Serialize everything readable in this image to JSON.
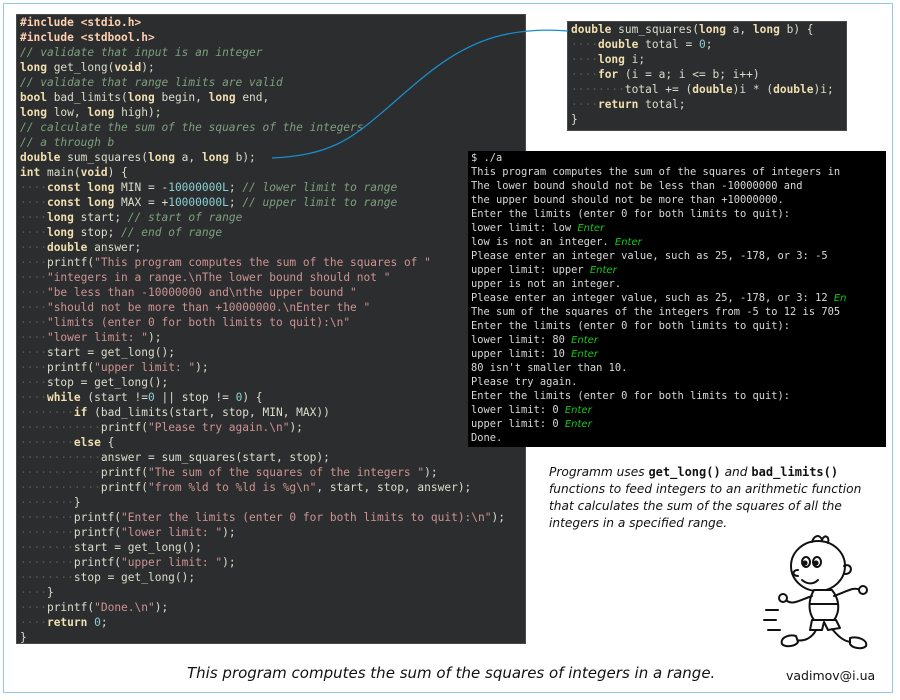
{
  "main_code": [
    [
      [
        "#include <stdio.h>",
        "pp"
      ]
    ],
    [
      [
        "#include <stdbool.h>",
        "pp"
      ]
    ],
    [
      [
        "// validate that input is an integer",
        "cm"
      ]
    ],
    [
      [
        "long",
        "kw"
      ],
      [
        " get_long(",
        ""
      ],
      [
        "void",
        "kw"
      ],
      [
        ");",
        ""
      ]
    ],
    [
      [
        "// validate that range limits are valid",
        "cm"
      ]
    ],
    [
      [
        "bool",
        "kw"
      ],
      [
        " bad_limits(",
        ""
      ],
      [
        "long",
        "kw"
      ],
      [
        " begin, ",
        ""
      ],
      [
        "long",
        "kw"
      ],
      [
        " end,",
        ""
      ]
    ],
    [
      [
        "long",
        "kw"
      ],
      [
        " low, ",
        ""
      ],
      [
        "long",
        "kw"
      ],
      [
        " high);",
        ""
      ]
    ],
    [
      [
        "// calculate the sum of the squares of the integers",
        "cm"
      ]
    ],
    [
      [
        "// a through b",
        "cm"
      ]
    ],
    [
      [
        "double",
        "kw"
      ],
      [
        " sum_squares(",
        ""
      ],
      [
        "long",
        "kw"
      ],
      [
        " a, ",
        ""
      ],
      [
        "long",
        "kw"
      ],
      [
        " b);",
        ""
      ]
    ],
    [
      [
        "int",
        "kw"
      ],
      [
        " main(",
        ""
      ],
      [
        "void",
        "kw"
      ],
      [
        ") {",
        ""
      ]
    ],
    [
      [
        "····",
        "ws"
      ],
      [
        "const long",
        "kw"
      ],
      [
        " MIN = -",
        ""
      ],
      [
        "10000000L",
        "nm"
      ],
      [
        "; ",
        ""
      ],
      [
        "// lower limit to range",
        "cm"
      ]
    ],
    [
      [
        "····",
        "ws"
      ],
      [
        "const long",
        "kw"
      ],
      [
        " MAX = +",
        ""
      ],
      [
        "10000000L",
        "nm"
      ],
      [
        "; ",
        ""
      ],
      [
        "// upper limit to range",
        "cm"
      ]
    ],
    [
      [
        "····",
        "ws"
      ],
      [
        "long",
        "kw"
      ],
      [
        " start; ",
        ""
      ],
      [
        "// start of range",
        "cm"
      ]
    ],
    [
      [
        "····",
        "ws"
      ],
      [
        "long",
        "kw"
      ],
      [
        " stop; ",
        ""
      ],
      [
        "// end of range",
        "cm"
      ]
    ],
    [
      [
        "····",
        "ws"
      ],
      [
        "double",
        "kw"
      ],
      [
        " answer;",
        ""
      ]
    ],
    [
      [
        "····",
        "ws"
      ],
      [
        "printf(",
        ""
      ],
      [
        "\"This program computes the sum of the squares of \"",
        "st"
      ]
    ],
    [
      [
        "····",
        "ws"
      ],
      [
        "\"integers in a range.\\nThe lower bound should not \"",
        "st"
      ]
    ],
    [
      [
        "····",
        "ws"
      ],
      [
        "\"be less than -10000000 and\\nthe upper bound \"",
        "st"
      ]
    ],
    [
      [
        "····",
        "ws"
      ],
      [
        "\"should not be more than +10000000.\\nEnter the \"",
        "st"
      ]
    ],
    [
      [
        "····",
        "ws"
      ],
      [
        "\"limits (enter 0 for both limits to quit):\\n\"",
        "st"
      ]
    ],
    [
      [
        "····",
        "ws"
      ],
      [
        "\"lower limit: \"",
        "st"
      ],
      [
        ");",
        ""
      ]
    ],
    [
      [
        "····",
        "ws"
      ],
      [
        "start = get_long();",
        ""
      ]
    ],
    [
      [
        "····",
        "ws"
      ],
      [
        "printf(",
        ""
      ],
      [
        "\"upper limit: \"",
        "st"
      ],
      [
        ");",
        ""
      ]
    ],
    [
      [
        "····",
        "ws"
      ],
      [
        "stop = get_long();",
        ""
      ]
    ],
    [
      [
        "····",
        "ws"
      ],
      [
        "while",
        "kw"
      ],
      [
        " (start !=",
        ""
      ],
      [
        "0",
        "nm"
      ],
      [
        " || stop != ",
        ""
      ],
      [
        "0",
        "nm"
      ],
      [
        ") {",
        ""
      ]
    ],
    [
      [
        "········",
        "ws"
      ],
      [
        "if",
        "kw"
      ],
      [
        " (bad_limits(start, stop, MIN, MAX))",
        ""
      ]
    ],
    [
      [
        "············",
        "ws"
      ],
      [
        "printf(",
        ""
      ],
      [
        "\"Please try again.\\n\"",
        "st"
      ],
      [
        ");",
        ""
      ]
    ],
    [
      [
        "········",
        "ws"
      ],
      [
        "else",
        "kw"
      ],
      [
        " {",
        ""
      ]
    ],
    [
      [
        "············",
        "ws"
      ],
      [
        "answer = sum_squares(start, stop);",
        ""
      ]
    ],
    [
      [
        "············",
        "ws"
      ],
      [
        "printf(",
        ""
      ],
      [
        "\"The sum of the squares of the integers \"",
        "st"
      ],
      [
        ");",
        ""
      ]
    ],
    [
      [
        "············",
        "ws"
      ],
      [
        "printf(",
        ""
      ],
      [
        "\"from %ld to %ld is %g\\n\"",
        "st"
      ],
      [
        ", start, stop, answer);",
        ""
      ]
    ],
    [
      [
        "········",
        "ws"
      ],
      [
        "}",
        ""
      ]
    ],
    [
      [
        "········",
        "ws"
      ],
      [
        "printf(",
        ""
      ],
      [
        "\"Enter the limits (enter 0 for both limits to quit):\\n\"",
        "st"
      ],
      [
        ");",
        ""
      ]
    ],
    [
      [
        "········",
        "ws"
      ],
      [
        "printf(",
        ""
      ],
      [
        "\"lower limit: \"",
        "st"
      ],
      [
        ");",
        ""
      ]
    ],
    [
      [
        "········",
        "ws"
      ],
      [
        "start = get_long();",
        ""
      ]
    ],
    [
      [
        "········",
        "ws"
      ],
      [
        "printf(",
        ""
      ],
      [
        "\"upper limit: \"",
        "st"
      ],
      [
        ");",
        ""
      ]
    ],
    [
      [
        "········",
        "ws"
      ],
      [
        "stop = get_long();",
        ""
      ]
    ],
    [
      [
        "····",
        "ws"
      ],
      [
        "}",
        ""
      ]
    ],
    [
      [
        "····",
        "ws"
      ],
      [
        "printf(",
        ""
      ],
      [
        "\"Done.\\n\"",
        "st"
      ],
      [
        ");",
        ""
      ]
    ],
    [
      [
        "····",
        "ws"
      ],
      [
        "return",
        "kw"
      ],
      [
        " ",
        ""
      ],
      [
        "0",
        "nm"
      ],
      [
        ";",
        ""
      ]
    ],
    [
      [
        "}",
        ""
      ]
    ]
  ],
  "function_code": [
    [
      [
        "double",
        "kw"
      ],
      [
        " sum_squares(",
        ""
      ],
      [
        "long",
        "kw"
      ],
      [
        " a, ",
        ""
      ],
      [
        "long",
        "kw"
      ],
      [
        " b) {",
        ""
      ]
    ],
    [
      [
        "····",
        "ws"
      ],
      [
        "double",
        "kw"
      ],
      [
        " total = ",
        ""
      ],
      [
        "0",
        "nm"
      ],
      [
        ";",
        ""
      ]
    ],
    [
      [
        "····",
        "ws"
      ],
      [
        "long",
        "kw"
      ],
      [
        " i;",
        ""
      ]
    ],
    [
      [
        "····",
        "ws"
      ],
      [
        "for",
        "kw"
      ],
      [
        " (i = a; i <= b; i++)",
        ""
      ]
    ],
    [
      [
        "········",
        "ws"
      ],
      [
        "total += (",
        ""
      ],
      [
        "double",
        "kw"
      ],
      [
        ")i * (",
        ""
      ],
      [
        "double",
        "kw"
      ],
      [
        ")i;",
        ""
      ]
    ],
    [
      [
        "····",
        "ws"
      ],
      [
        "return",
        "kw"
      ],
      [
        " total;",
        ""
      ]
    ],
    [
      [
        "}",
        ""
      ]
    ]
  ],
  "terminal": [
    [
      "$ ./a",
      ""
    ],
    [
      "This program computes the sum of the squares of integers in",
      ""
    ],
    [
      "The lower bound should not be less than -10000000 and",
      ""
    ],
    [
      "the upper bound should not be more than +10000000.",
      ""
    ],
    [
      "Enter the limits (enter 0 for both limits to quit):",
      ""
    ],
    [
      "lower limit: low ",
      "Enter"
    ],
    [
      "low is not an integer. ",
      "Enter"
    ],
    [
      "Please enter an integer value, such as 25, -178, or 3: -5",
      ""
    ],
    [
      "upper limit: upper ",
      "Enter"
    ],
    [
      "upper is not an integer.",
      ""
    ],
    [
      "Please enter an integer value, such as 25, -178, or 3: 12 ",
      "En"
    ],
    [
      "The sum of the squares of the integers from -5 to 12 is 705",
      ""
    ],
    [
      "Enter the limits (enter 0 for both limits to quit):",
      ""
    ],
    [
      "lower limit: 80 ",
      "Enter"
    ],
    [
      "upper limit: 10 ",
      "Enter"
    ],
    [
      "80 isn't smaller than 10.",
      ""
    ],
    [
      "Please try again.",
      ""
    ],
    [
      "Enter the limits (enter 0 for both limits to quit):",
      ""
    ],
    [
      "lower limit: 0 ",
      "Enter"
    ],
    [
      "upper limit: 0 ",
      "Enter"
    ],
    [
      "Done.",
      ""
    ]
  ],
  "caption": {
    "prefix": "Programm uses ",
    "fn1": "get_long()",
    "mid": " and ",
    "fn2": "bad_limits()",
    "suffix": " functions to feed integers to an arithmetic function that calculates the sum of the squares of all the integers in a specified range."
  },
  "footer": {
    "title": "This program computes the sum of the squares of integers in a range.",
    "email": "vadimov@i.ua"
  },
  "colors": {
    "code_bg": "#2b2d2f",
    "terminal_bg": "#000000",
    "connector": "#1a8ccc",
    "enter_hint": "#18c818"
  },
  "icons": {
    "mascot": "running-cartoon-boy"
  }
}
